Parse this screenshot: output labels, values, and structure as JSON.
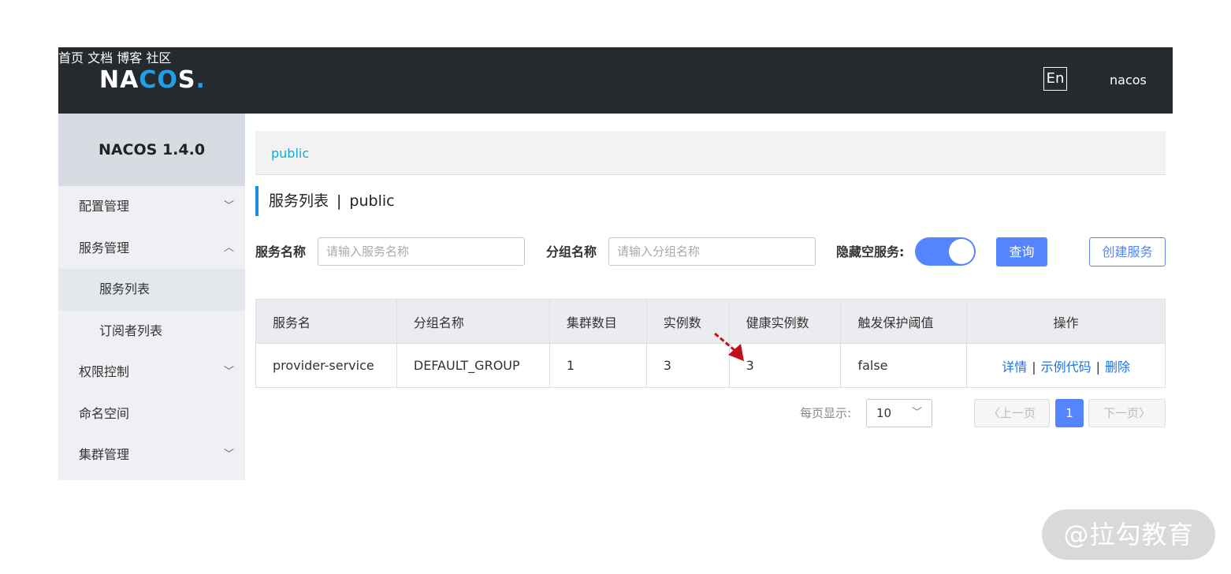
{
  "header": {
    "logo_text": "NACOS.",
    "nav": [
      "首页",
      "文档",
      "博客",
      "社区"
    ],
    "lang": "En",
    "user": "nacos"
  },
  "sidebar": {
    "title": "NACOS 1.4.0",
    "items": [
      {
        "label": "配置管理"
      },
      {
        "label": "服务管理"
      },
      {
        "label": "服务列表"
      },
      {
        "label": "订阅者列表"
      },
      {
        "label": "权限控制"
      },
      {
        "label": "命名空间"
      },
      {
        "label": "集群管理"
      }
    ]
  },
  "breadcrumb": "public",
  "page": {
    "title": "服务列表",
    "sep": "|",
    "namespace": "public"
  },
  "filter": {
    "service_label": "服务名称",
    "service_placeholder": "请输入服务名称",
    "group_label": "分组名称",
    "group_placeholder": "请输入分组名称",
    "hide_label": "隐藏空服务:",
    "hide_empty": true,
    "query_label": "查询",
    "create_label": "创建服务"
  },
  "table": {
    "headers": [
      "服务名",
      "分组名称",
      "集群数目",
      "实例数",
      "健康实例数",
      "触发保护阈值",
      "操作"
    ],
    "rows": [
      {
        "service": "provider-service",
        "group": "DEFAULT_GROUP",
        "clusters": "1",
        "instances": "3",
        "healthy": "3",
        "threshold": "false",
        "ops": [
          "详情",
          "示例代码",
          "删除"
        ],
        "op_sep": "|"
      }
    ]
  },
  "pagination": {
    "page_size_label": "每页显示:",
    "page_size": "10",
    "prev": "上一页",
    "next": "下一页",
    "current": "1"
  },
  "watermark": "@拉勾教育",
  "colors": {
    "topbar": "#252a2f",
    "primary": "#5584ff",
    "link": "#1f73db",
    "accent": "#1790de",
    "annotation_arrow": "#c0101a"
  }
}
